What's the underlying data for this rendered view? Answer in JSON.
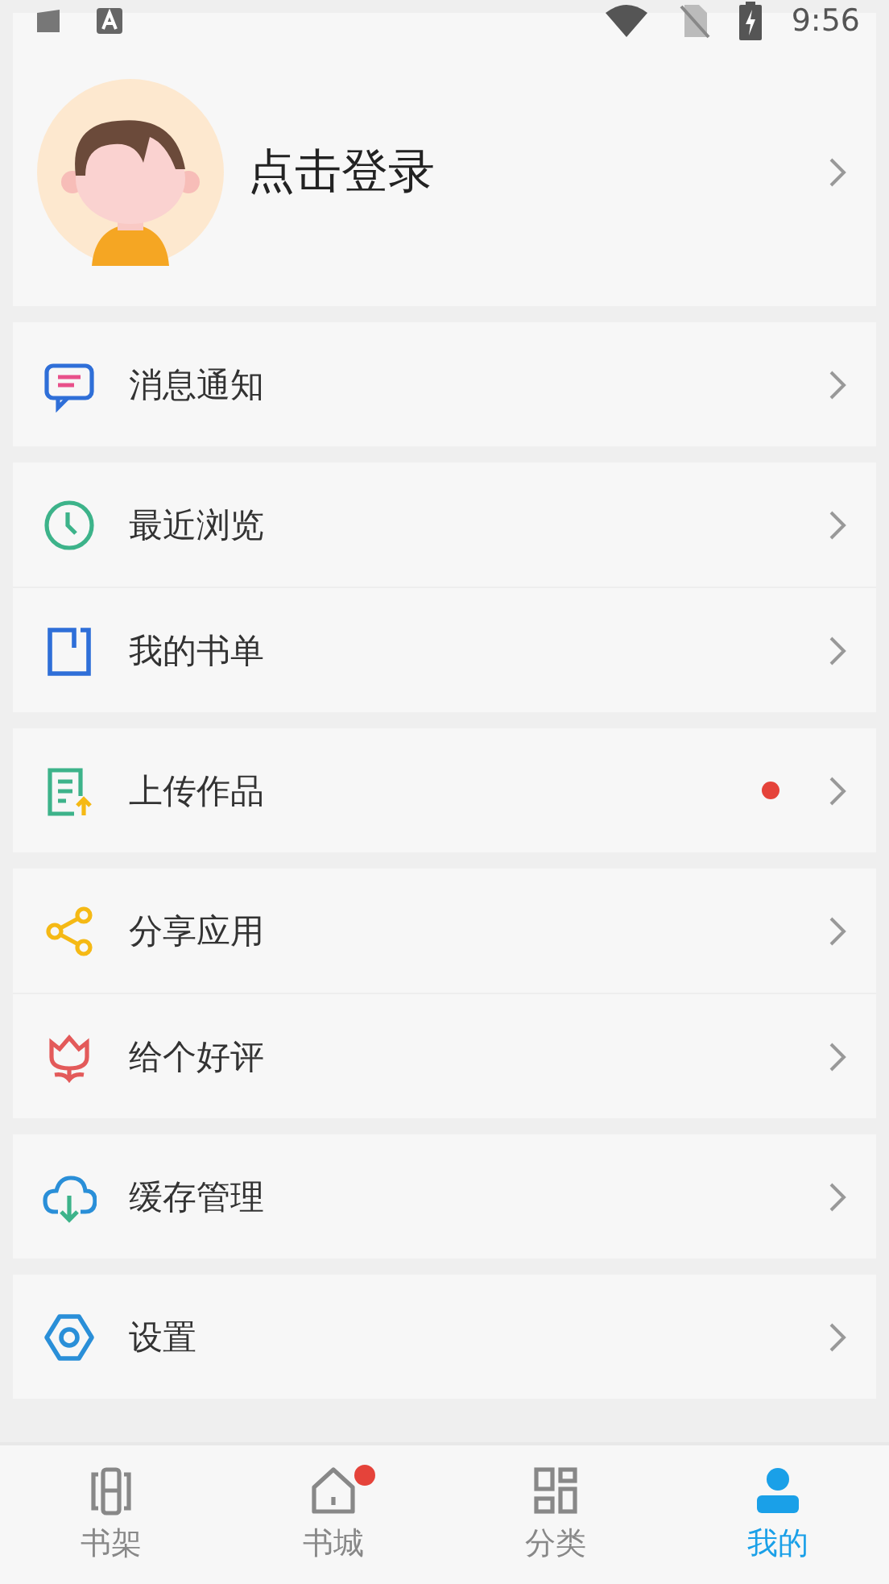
{
  "status_bar": {
    "time": "9:56"
  },
  "profile": {
    "label": "点击登录"
  },
  "menu_groups": [
    {
      "items": [
        {
          "label": "消息通知",
          "dot": false
        }
      ]
    },
    {
      "items": [
        {
          "label": "最近浏览",
          "dot": false
        },
        {
          "label": "我的书单",
          "dot": false
        }
      ]
    },
    {
      "items": [
        {
          "label": "上传作品",
          "dot": true
        }
      ]
    },
    {
      "items": [
        {
          "label": "分享应用",
          "dot": false
        },
        {
          "label": "给个好评",
          "dot": false
        }
      ]
    },
    {
      "items": [
        {
          "label": "缓存管理",
          "dot": false
        }
      ]
    },
    {
      "items": [
        {
          "label": "设置",
          "dot": false
        }
      ]
    }
  ],
  "tabs": [
    {
      "label": "书架",
      "selected": false,
      "dot": false
    },
    {
      "label": "书城",
      "selected": false,
      "dot": true
    },
    {
      "label": "分类",
      "selected": false,
      "dot": false
    },
    {
      "label": "我的",
      "selected": true,
      "dot": false
    }
  ]
}
